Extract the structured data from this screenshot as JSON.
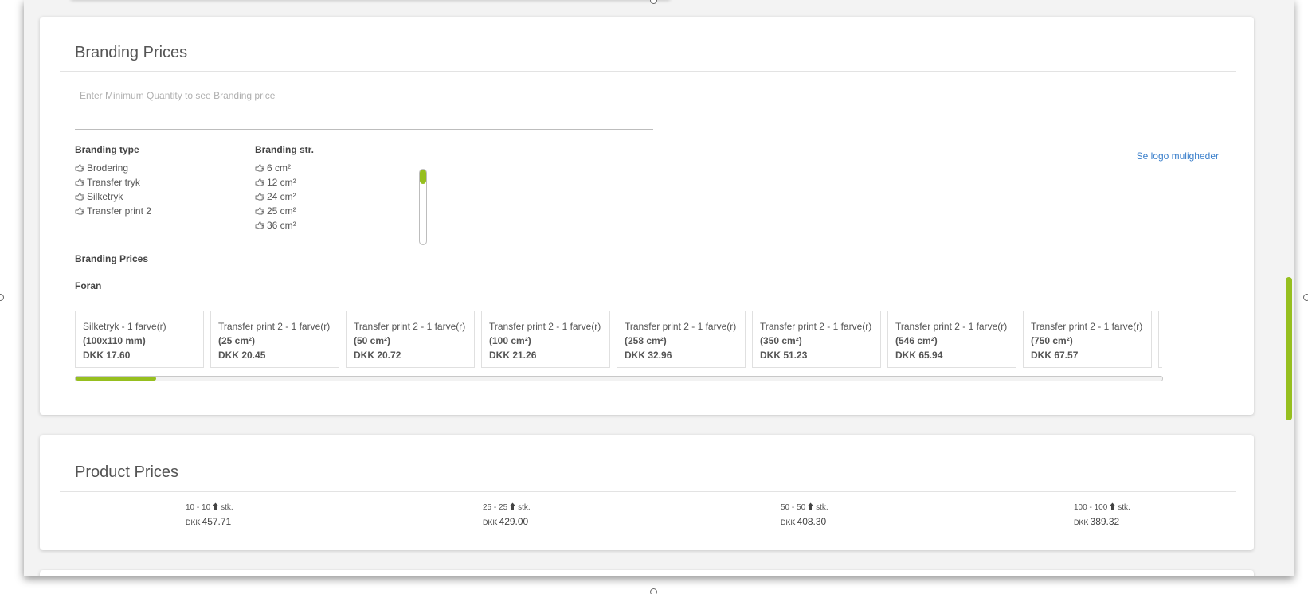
{
  "branding": {
    "title": "Branding Prices",
    "quantity_placeholder": "Enter Minimum Quantity to see Branding price",
    "type_heading": "Branding type",
    "types": [
      "Brodering",
      "Transfer tryk",
      "Silketryk",
      "Transfer print 2"
    ],
    "size_heading": "Branding str.",
    "sizes": [
      "6 cm²",
      "12 cm²",
      "24 cm²",
      "25 cm²",
      "36 cm²"
    ],
    "logo_link": "Se logo muligheder",
    "prices_heading": "Branding Prices",
    "position_label": "Foran",
    "price_cards": [
      {
        "name": "Silketryk - 1 farve(r)",
        "size": "(100x110 mm)",
        "price": "DKK 17.60"
      },
      {
        "name": "Transfer print 2 - 1 farve(r)",
        "size": "(25 cm²)",
        "price": "DKK 20.45"
      },
      {
        "name": "Transfer print 2 - 1 farve(r)",
        "size": "(50 cm²)",
        "price": "DKK 20.72"
      },
      {
        "name": "Transfer print 2 - 1 farve(r)",
        "size": "(100 cm²)",
        "price": "DKK 21.26"
      },
      {
        "name": "Transfer print 2 - 1 farve(r)",
        "size": "(258 cm²)",
        "price": "DKK 32.96"
      },
      {
        "name": "Transfer print 2 - 1 farve(r)",
        "size": "(350 cm²)",
        "price": "DKK 51.23"
      },
      {
        "name": "Transfer print 2 - 1 farve(r)",
        "size": "(546 cm²)",
        "price": "DKK 65.94"
      },
      {
        "name": "Transfer print 2 - 1 farve(r)",
        "size": "(750 cm²)",
        "price": "DKK 67.57"
      },
      {
        "name": "",
        "size": "",
        "price": ""
      }
    ],
    "card_scroll_position": 0.07,
    "list_scroll_position": 0
  },
  "product": {
    "title": "Product Prices",
    "tiers": [
      {
        "range": "10 - 10",
        "unit": "stk.",
        "currency": "DKK",
        "price": "457.71"
      },
      {
        "range": "25 - 25",
        "unit": "stk.",
        "currency": "DKK",
        "price": "429.00"
      },
      {
        "range": "50 - 50",
        "unit": "stk.",
        "currency": "DKK",
        "price": "408.30"
      },
      {
        "range": "100 - 100",
        "unit": "stk.",
        "currency": "DKK",
        "price": "389.32"
      }
    ]
  },
  "icons": {
    "option_icon": "hand-pointer-right-icon",
    "tier_icon": "arrow-up-icon"
  },
  "colors": {
    "accent": "#96bf1f",
    "link": "#3a7fcb"
  }
}
